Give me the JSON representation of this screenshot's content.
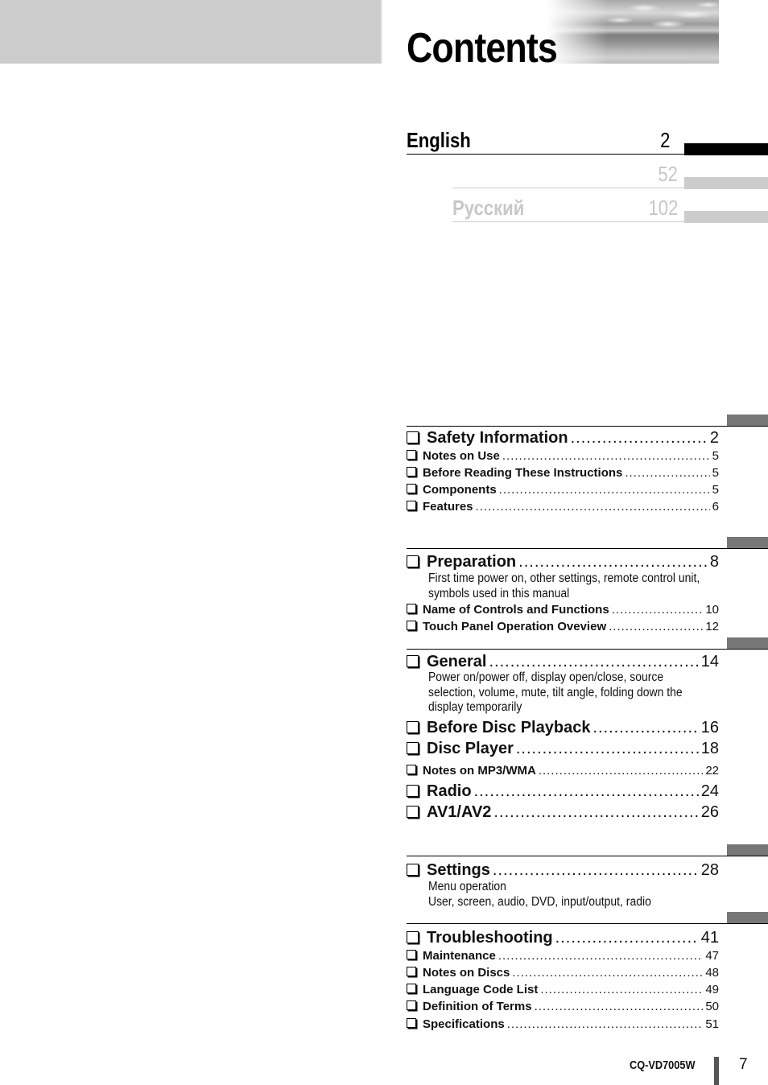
{
  "page": {
    "title": "Contents",
    "model": "CQ-VD7005W",
    "page_number": "7"
  },
  "languages": [
    {
      "label": "English",
      "page": "2",
      "active": true
    },
    {
      "label": "",
      "page": "52",
      "active": false
    },
    {
      "label": "Русский",
      "page": "102",
      "active": false
    }
  ],
  "colors": {
    "active_tab": "#000000",
    "inactive_tab": "#cccccc",
    "inactive_text": "#c8c8c8",
    "section_tab": "#777777",
    "left_band": "#cccccc"
  },
  "sections": [
    {
      "items": [
        {
          "label": "Safety Information",
          "page": "2",
          "level": "major"
        },
        {
          "label": "Notes on Use",
          "page": "5",
          "level": "minor"
        },
        {
          "label": "Before Reading These Instructions",
          "page": "5",
          "level": "minor"
        },
        {
          "label": "Components",
          "page": "5",
          "level": "minor"
        },
        {
          "label": "Features",
          "page": "6",
          "level": "minor"
        }
      ]
    },
    {
      "items": [
        {
          "label": "Preparation",
          "page": "8",
          "level": "major",
          "description": "First time power on, other settings, remote control unit, symbols used in this manual"
        },
        {
          "label": "Name of Controls and Functions",
          "page": "10",
          "level": "minor"
        },
        {
          "label": "Touch Panel Operation Oveview",
          "page": "12",
          "level": "minor"
        }
      ]
    },
    {
      "items": [
        {
          "label": "General",
          "page": "14",
          "level": "major",
          "description": "Power on/power off, display open/close, source selection, volume, mute, tilt angle, folding down the display temporarily"
        },
        {
          "label": "Before Disc Playback",
          "page": "16",
          "level": "major"
        },
        {
          "label": "Disc Player",
          "page": "18",
          "level": "major"
        },
        {
          "label": "Notes on MP3/WMA",
          "page": "22",
          "level": "minor"
        },
        {
          "label": "Radio",
          "page": "24",
          "level": "major"
        },
        {
          "label": "AV1/AV2",
          "page": "26",
          "level": "major"
        }
      ]
    },
    {
      "items": [
        {
          "label": "Settings",
          "page": "28",
          "level": "major",
          "description": "Menu operation\nUser, screen, audio, DVD, input/output, radio"
        }
      ]
    },
    {
      "items": [
        {
          "label": "Troubleshooting",
          "page": "41",
          "level": "major"
        },
        {
          "label": "Maintenance",
          "page": "47",
          "level": "minor"
        },
        {
          "label": "Notes on Discs",
          "page": "48",
          "level": "minor"
        },
        {
          "label": "Language Code List",
          "page": "49",
          "level": "minor"
        },
        {
          "label": "Definition of Terms",
          "page": "50",
          "level": "minor"
        },
        {
          "label": "Specifications",
          "page": "51",
          "level": "minor"
        }
      ]
    }
  ]
}
